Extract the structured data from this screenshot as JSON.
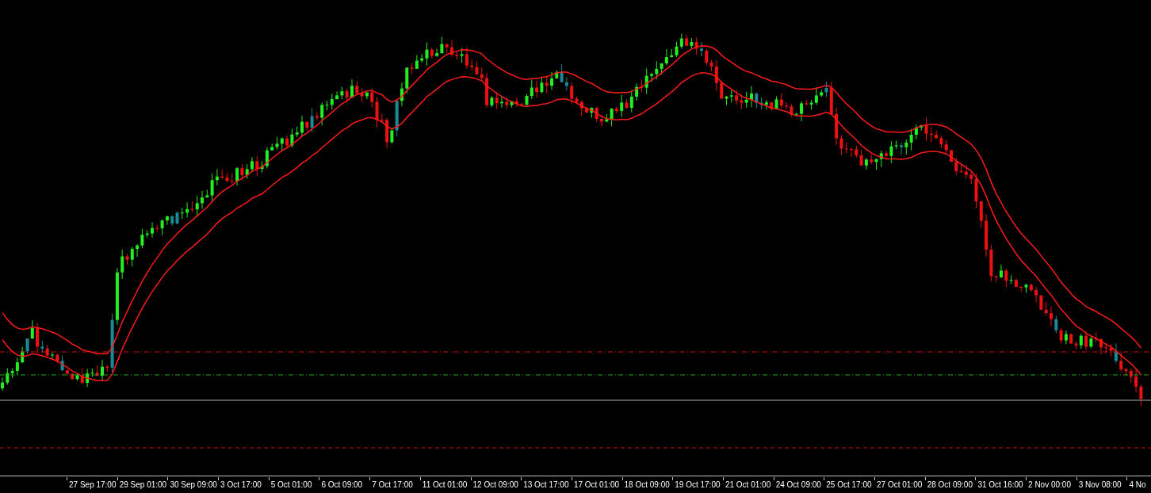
{
  "time_axis": {
    "labels": [
      "27 Sep 17:00",
      "29 Sep 01:00",
      "30 Sep 09:00",
      "3 Oct 17:00",
      "5 Oct 01:00",
      "6 Oct 09:00",
      "7 Oct 17:00",
      "11 Oct 01:00",
      "12 Oct 09:00",
      "13 Oct 17:00",
      "17 Oct 01:00",
      "18 Oct 09:00",
      "19 Oct 17:00",
      "21 Oct 01:00",
      "24 Oct 09:00",
      "25 Oct 17:00",
      "27 Oct 01:00",
      "28 Oct 09:00",
      "31 Oct 16:00",
      "2 Nov 00:00",
      "3 Nov 08:00",
      "4 No"
    ]
  }
}
